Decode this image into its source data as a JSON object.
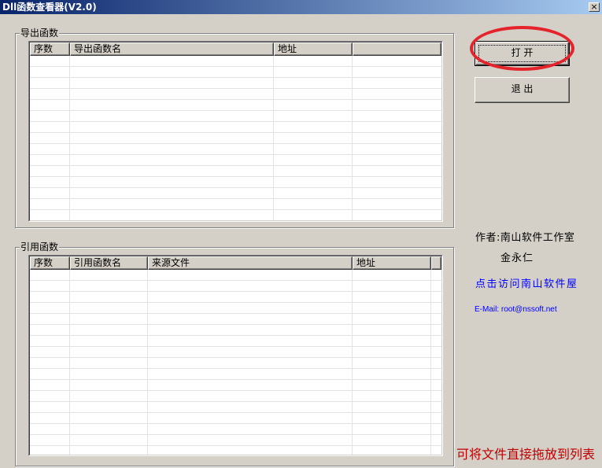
{
  "window": {
    "title": "Dll函数查看器(V2.0)",
    "close_glyph": "×"
  },
  "export_group": {
    "label": "导出函数",
    "columns": [
      "序数",
      "导出函数名",
      "地址"
    ]
  },
  "import_group": {
    "label": "引用函数",
    "columns": [
      "序数",
      "引用函数名",
      "来源文件",
      "地址"
    ]
  },
  "buttons": {
    "open": "打 开",
    "exit": "退 出"
  },
  "info": {
    "author": "作者:南山软件工作室",
    "author_name": "金永仁",
    "visit_link": "点击访问南山软件屋",
    "email": "E-Mail: root@nssoft.net"
  },
  "hint": "可将文件直接拖放到列表",
  "colors": {
    "window_face": "#D4D0C8",
    "title_gradient_start": "#0A246A",
    "title_gradient_end": "#A6CAF0",
    "link": "#0000FF",
    "hint": "#C00000",
    "annotation": "#E5232B"
  }
}
